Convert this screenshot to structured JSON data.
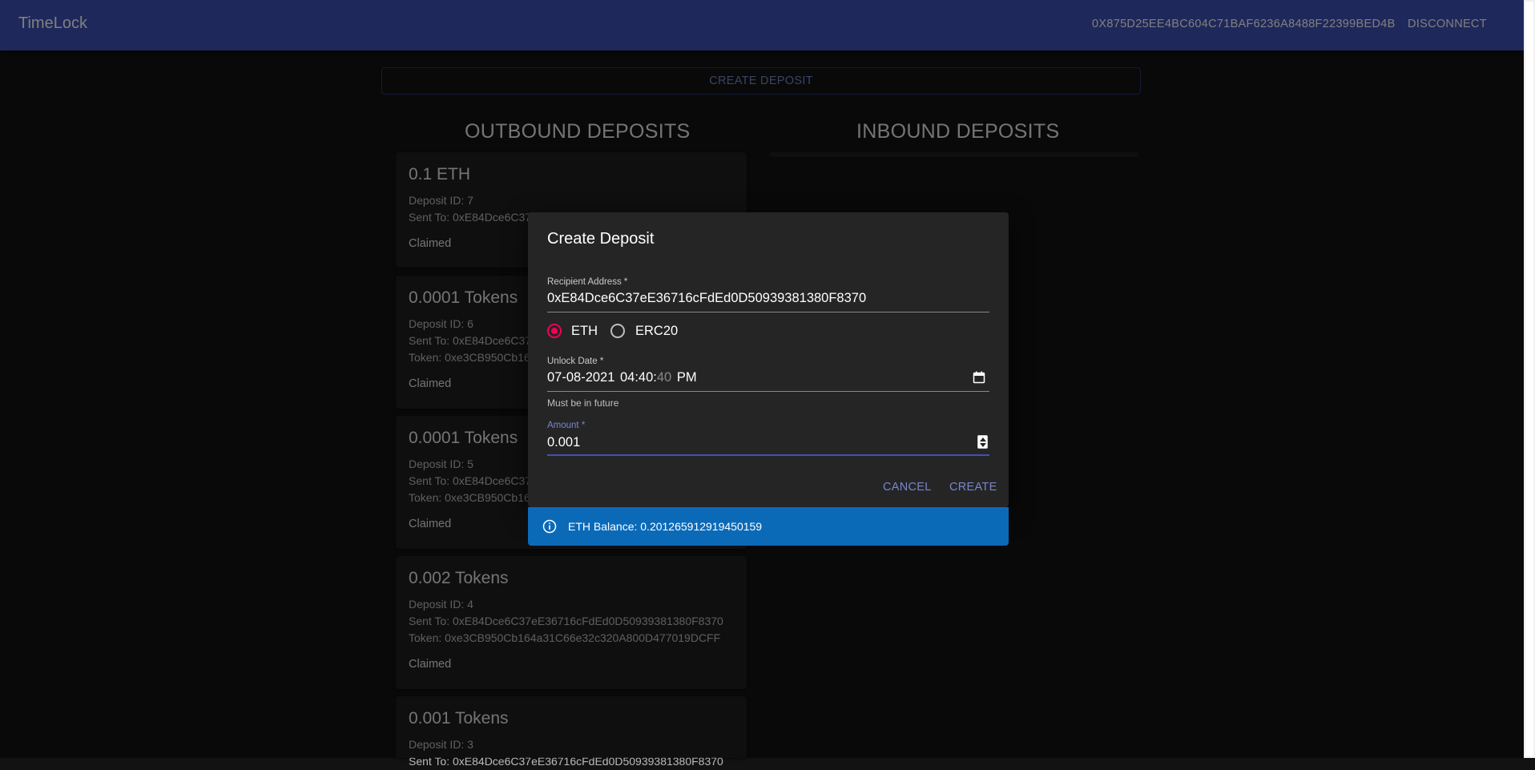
{
  "appbar": {
    "title": "TimeLock",
    "account": "0X875D25EE4BC604C71BAF6236A8488F22399BED4B",
    "disconnect_label": "DISCONNECT"
  },
  "create_deposit_label": "CREATE DEPOSIT",
  "outbound_title": "OUTBOUND DEPOSITS",
  "inbound_title": "INBOUND DEPOSITS",
  "deposits": [
    {
      "amount": "0.1 ETH",
      "id": "Deposit ID: 7",
      "sent_to": "Sent To: 0xE84Dce6C37eE36716cFdEd0D50939381380F8370",
      "status": "Claimed"
    },
    {
      "amount": "0.0001 Tokens",
      "id": "Deposit ID: 6",
      "sent_to": "Sent To: 0xE84Dce6C37eE36716cFdEd0D50939381380F8370",
      "token": "Token: 0xe3CB950Cb164a31C66e32c320A800D477019DCFF",
      "status": "Claimed"
    },
    {
      "amount": "0.0001 Tokens",
      "id": "Deposit ID: 5",
      "sent_to": "Sent To: 0xE84Dce6C37eE36716cFdEd0D50939381380F8370",
      "token": "Token: 0xe3CB950Cb164a31C66e32c320A800D477019DCFF",
      "status": "Claimed"
    },
    {
      "amount": "0.002 Tokens",
      "id": "Deposit ID: 4",
      "sent_to": "Sent To: 0xE84Dce6C37eE36716cFdEd0D50939381380F8370",
      "token": "Token: 0xe3CB950Cb164a31C66e32c320A800D477019DCFF",
      "status": "Claimed"
    },
    {
      "amount": "0.001 Tokens",
      "id": "Deposit ID: 3",
      "sent_to": "Sent To: 0xE84Dce6C37eE36716cFdEd0D50939381380F8370"
    }
  ],
  "dialog": {
    "title": "Create Deposit",
    "recipient_label": "Recipient Address *",
    "recipient_value": "0xE84Dce6C37eE36716cFdEd0D50939381380F8370",
    "radio_eth": "ETH",
    "radio_erc20": "ERC20",
    "selected_asset": "ETH",
    "unlock_label": "Unlock Date *",
    "unlock_date": "07-08-2021",
    "unlock_time": "04:40:",
    "unlock_seconds": "40",
    "unlock_ampm": "PM",
    "unlock_helper": "Must be in future",
    "amount_label": "Amount *",
    "amount_value": "0.001",
    "cancel_label": "CANCEL",
    "create_label": "CREATE"
  },
  "alert": {
    "icon": "info-icon",
    "text": "ETH Balance: 0.201265912919450159"
  },
  "colors": {
    "appbar": "#3f51b5",
    "accent_radio": "#f50057",
    "alert": "#0b6ab8",
    "background": "#121212"
  }
}
